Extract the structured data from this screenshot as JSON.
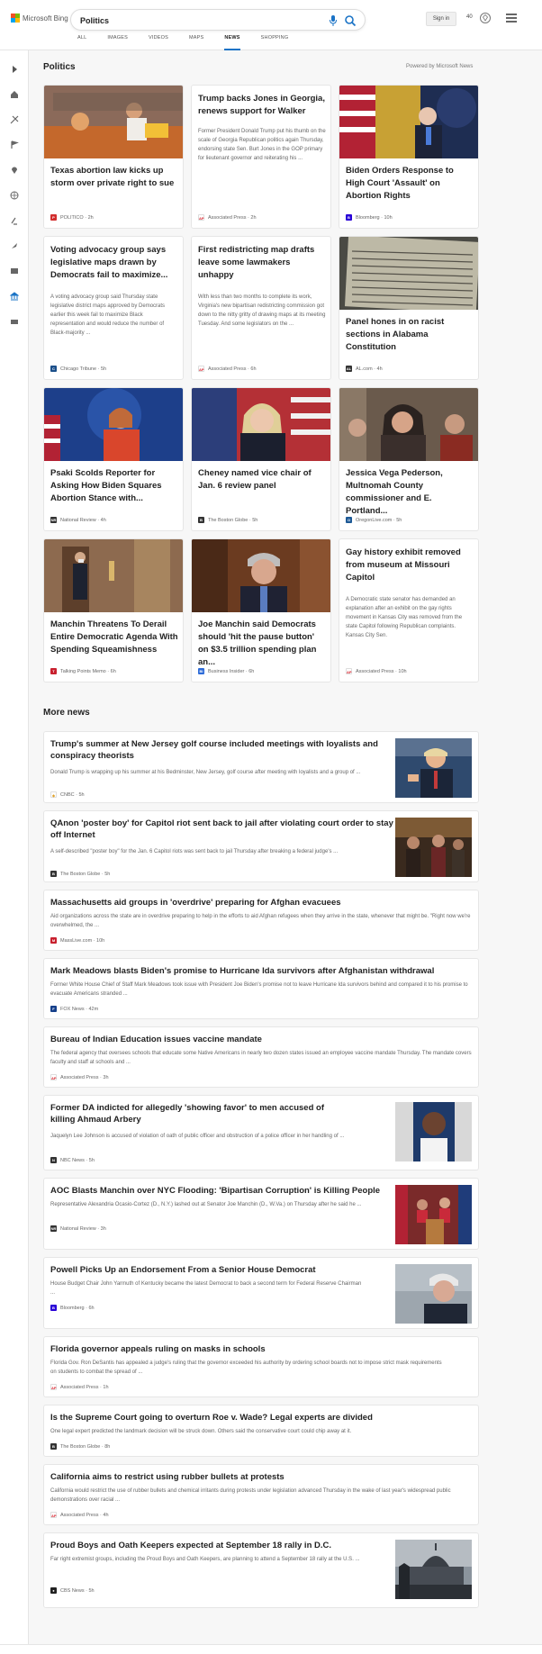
{
  "header": {
    "brand": "Microsoft Bing",
    "search_value": "Politics",
    "signin_label": "Sign in",
    "points": "40",
    "tabs": [
      "ALL",
      "IMAGES",
      "VIDEOS",
      "MAPS",
      "NEWS",
      "SHOPPING"
    ],
    "active_tab": "NEWS"
  },
  "section": {
    "title": "Politics",
    "powered_by": "Powered by Microsoft News"
  },
  "cards": [
    {
      "title": "Texas abortion law kicks up storm over private right to sue",
      "description": "",
      "source": "POLITICO",
      "time": "2h",
      "has_image": true
    },
    {
      "title": "Trump backs Jones in Georgia, renews support for Walker",
      "description": "Former President Donald Trump put his thumb on the scale of Georgia Republican politics again Thursday, endorsing state Sen. Burt Jones in the GOP primary for lieutenant governor and reiterating his ...",
      "source": "Associated Press",
      "time": "2h",
      "has_image": false
    },
    {
      "title": "Biden Orders Response to High Court 'Assault' on Abortion Rights",
      "description": "",
      "source": "Bloomberg",
      "time": "10h",
      "has_image": true
    },
    {
      "title": "Voting advocacy group says legislative maps drawn by Democrats fail to maximize...",
      "description": "A voting advocacy group said Thursday state legislative district maps approved by Democrats earlier this week fail to maximize Black representation and would reduce the number of Black-majority ...",
      "source": "Chicago Tribune",
      "time": "5h",
      "has_image": false
    },
    {
      "title": "First redistricting map drafts leave some lawmakers unhappy",
      "description": "With less than two months to complete its work, Virginia's new bipartisan redistricting commission got down to the nitty gritty of drawing maps at its meeting Tuesday. And some legislators on the ...",
      "source": "Associated Press",
      "time": "6h",
      "has_image": false
    },
    {
      "title": "Panel hones in on racist sections in Alabama Constitution",
      "description": "",
      "source": "AL.com",
      "time": "4h",
      "has_image": true
    },
    {
      "title": "Psaki Scolds Reporter for Asking How Biden Squares Abortion Stance with...",
      "description": "",
      "source": "National Review",
      "time": "4h",
      "has_image": true
    },
    {
      "title": "Cheney named vice chair of Jan. 6 review panel",
      "description": "",
      "source": "The Boston Globe",
      "time": "5h",
      "has_image": true
    },
    {
      "title": "Jessica Vega Pederson, Multnomah County commissioner and E. Portland...",
      "description": "",
      "source": "OregonLive.com",
      "time": "5h",
      "has_image": true
    },
    {
      "title": "Manchin Threatens To Derail Entire Democratic Agenda With Spending Squeamishness",
      "description": "",
      "source": "Talking Points Memo",
      "time": "6h",
      "has_image": true
    },
    {
      "title": "Joe Manchin said Democrats should 'hit the pause button' on $3.5 trillion spending plan an...",
      "description": "",
      "source": "Business Insider",
      "time": "6h",
      "has_image": true
    },
    {
      "title": "Gay history exhibit removed from museum at Missouri Capitol",
      "description": "A Democratic state senator has demanded an explanation after an exhibit on the gay rights movement in Kansas City was removed from the state Capitol following Republican complaints. Kansas City Sen.",
      "source": "Associated Press",
      "time": "10h",
      "has_image": false
    }
  ],
  "more_news_title": "More news",
  "more_news": [
    {
      "title": "Trump's summer at New Jersey golf course included meetings with loyalists and conspiracy theorists",
      "description": "Donald Trump is wrapping up his summer at his Bedminster, New Jersey, golf course after meeting with loyalists and a group of ...",
      "source": "CNBC",
      "time": "5h"
    },
    {
      "title": "QAnon 'poster boy' for Capitol riot sent back to jail after violating court order to stay off Internet",
      "description": "A self-described \"poster boy\" for the Jan. 6 Capitol riots was sent back to jail Thursday after breaking a federal judge's ...",
      "source": "The Boston Globe",
      "time": "5h"
    },
    {
      "title": "Massachusetts aid groups in 'overdrive' preparing for Afghan evacuees",
      "description": "Aid organizations across the state are in overdrive preparing to help in the efforts to aid Afghan refugees when they arrive in the state, whenever that might be. \"Right now we're overwhelmed, the ...",
      "source": "MassLive.com",
      "time": "10h"
    },
    {
      "title": "Mark Meadows blasts Biden's promise to Hurricane Ida survivors after Afghanistan withdrawal",
      "description": "Former White House Chief of Staff Mark Meadows took issue with President Joe Biden's promise not to leave Hurricane Ida survivors behind and compared it to his promise to evacuate Americans stranded ...",
      "source": "FOX News",
      "time": "42m"
    },
    {
      "title": "Bureau of Indian Education issues vaccine mandate",
      "description": "The federal agency that oversees schools that educate some Native Americans in nearly two dozen states issued an employee vaccine mandate Thursday. The mandate covers faculty and staff at schools and ...",
      "source": "Associated Press",
      "time": "3h"
    },
    {
      "title": "Former DA indicted for allegedly 'showing favor' to men accused of killing Ahmaud Arbery",
      "description": "Jaquelyn Lee Johnson is accused of violation of oath of public officer and obstruction of a police officer in her handling of ...",
      "source": "NBC News",
      "time": "5h"
    },
    {
      "title": "AOC Blasts Manchin over NYC Flooding: 'Bipartisan Corruption' is Killing People",
      "description": "Representative Alexandria Ocasio-Cortez (D., N.Y.) lashed out at Senator Joe Manchin (D., W.Va.) on Thursday after he said he ...",
      "source": "National Review",
      "time": "3h"
    },
    {
      "title": "Powell Picks Up an Endorsement From a Senior House Democrat",
      "description": "House Budget Chair John Yarmuth of Kentucky became the latest Democrat to back a second term for Federal Reserve Chairman ...",
      "source": "Bloomberg",
      "time": "6h"
    },
    {
      "title": "Florida governor appeals ruling on masks in schools",
      "description": "Florida Gov. Ron DeSantis has appealed a judge's ruling that the governor exceeded his authority by ordering school boards not to impose strict mask requirements on students to combat the spread of ...",
      "source": "Associated Press",
      "time": "1h"
    },
    {
      "title": "Is the Supreme Court going to overturn Roe v. Wade? Legal experts are divided",
      "description": "One legal expert predicted the landmark decision will be struck down. Others said the conservative court could chip away at it.",
      "source": "The Boston Globe",
      "time": "8h"
    },
    {
      "title": "California aims to restrict using rubber bullets at protests",
      "description": "California would restrict the use of rubber bullets and chemical irritants during protests under legislation advanced Thursday in the wake of last year's widespread public demonstrations over racial ...",
      "source": "Associated Press",
      "time": "4h"
    },
    {
      "title": "Proud Boys and Oath Keepers expected at September 18 rally in D.C.",
      "description": "Far right extremist groups, including the Proud Boys and Oath Keepers, are planning to attend a September 18 rally at the U.S. ...",
      "source": "CBS News",
      "time": "5h"
    }
  ],
  "colors": {
    "accent": "#1a73c6",
    "politico": "#d22e2e",
    "ap": "#d9232d",
    "bloomberg": "#2800d7",
    "tribune": "#1b4f8a"
  }
}
